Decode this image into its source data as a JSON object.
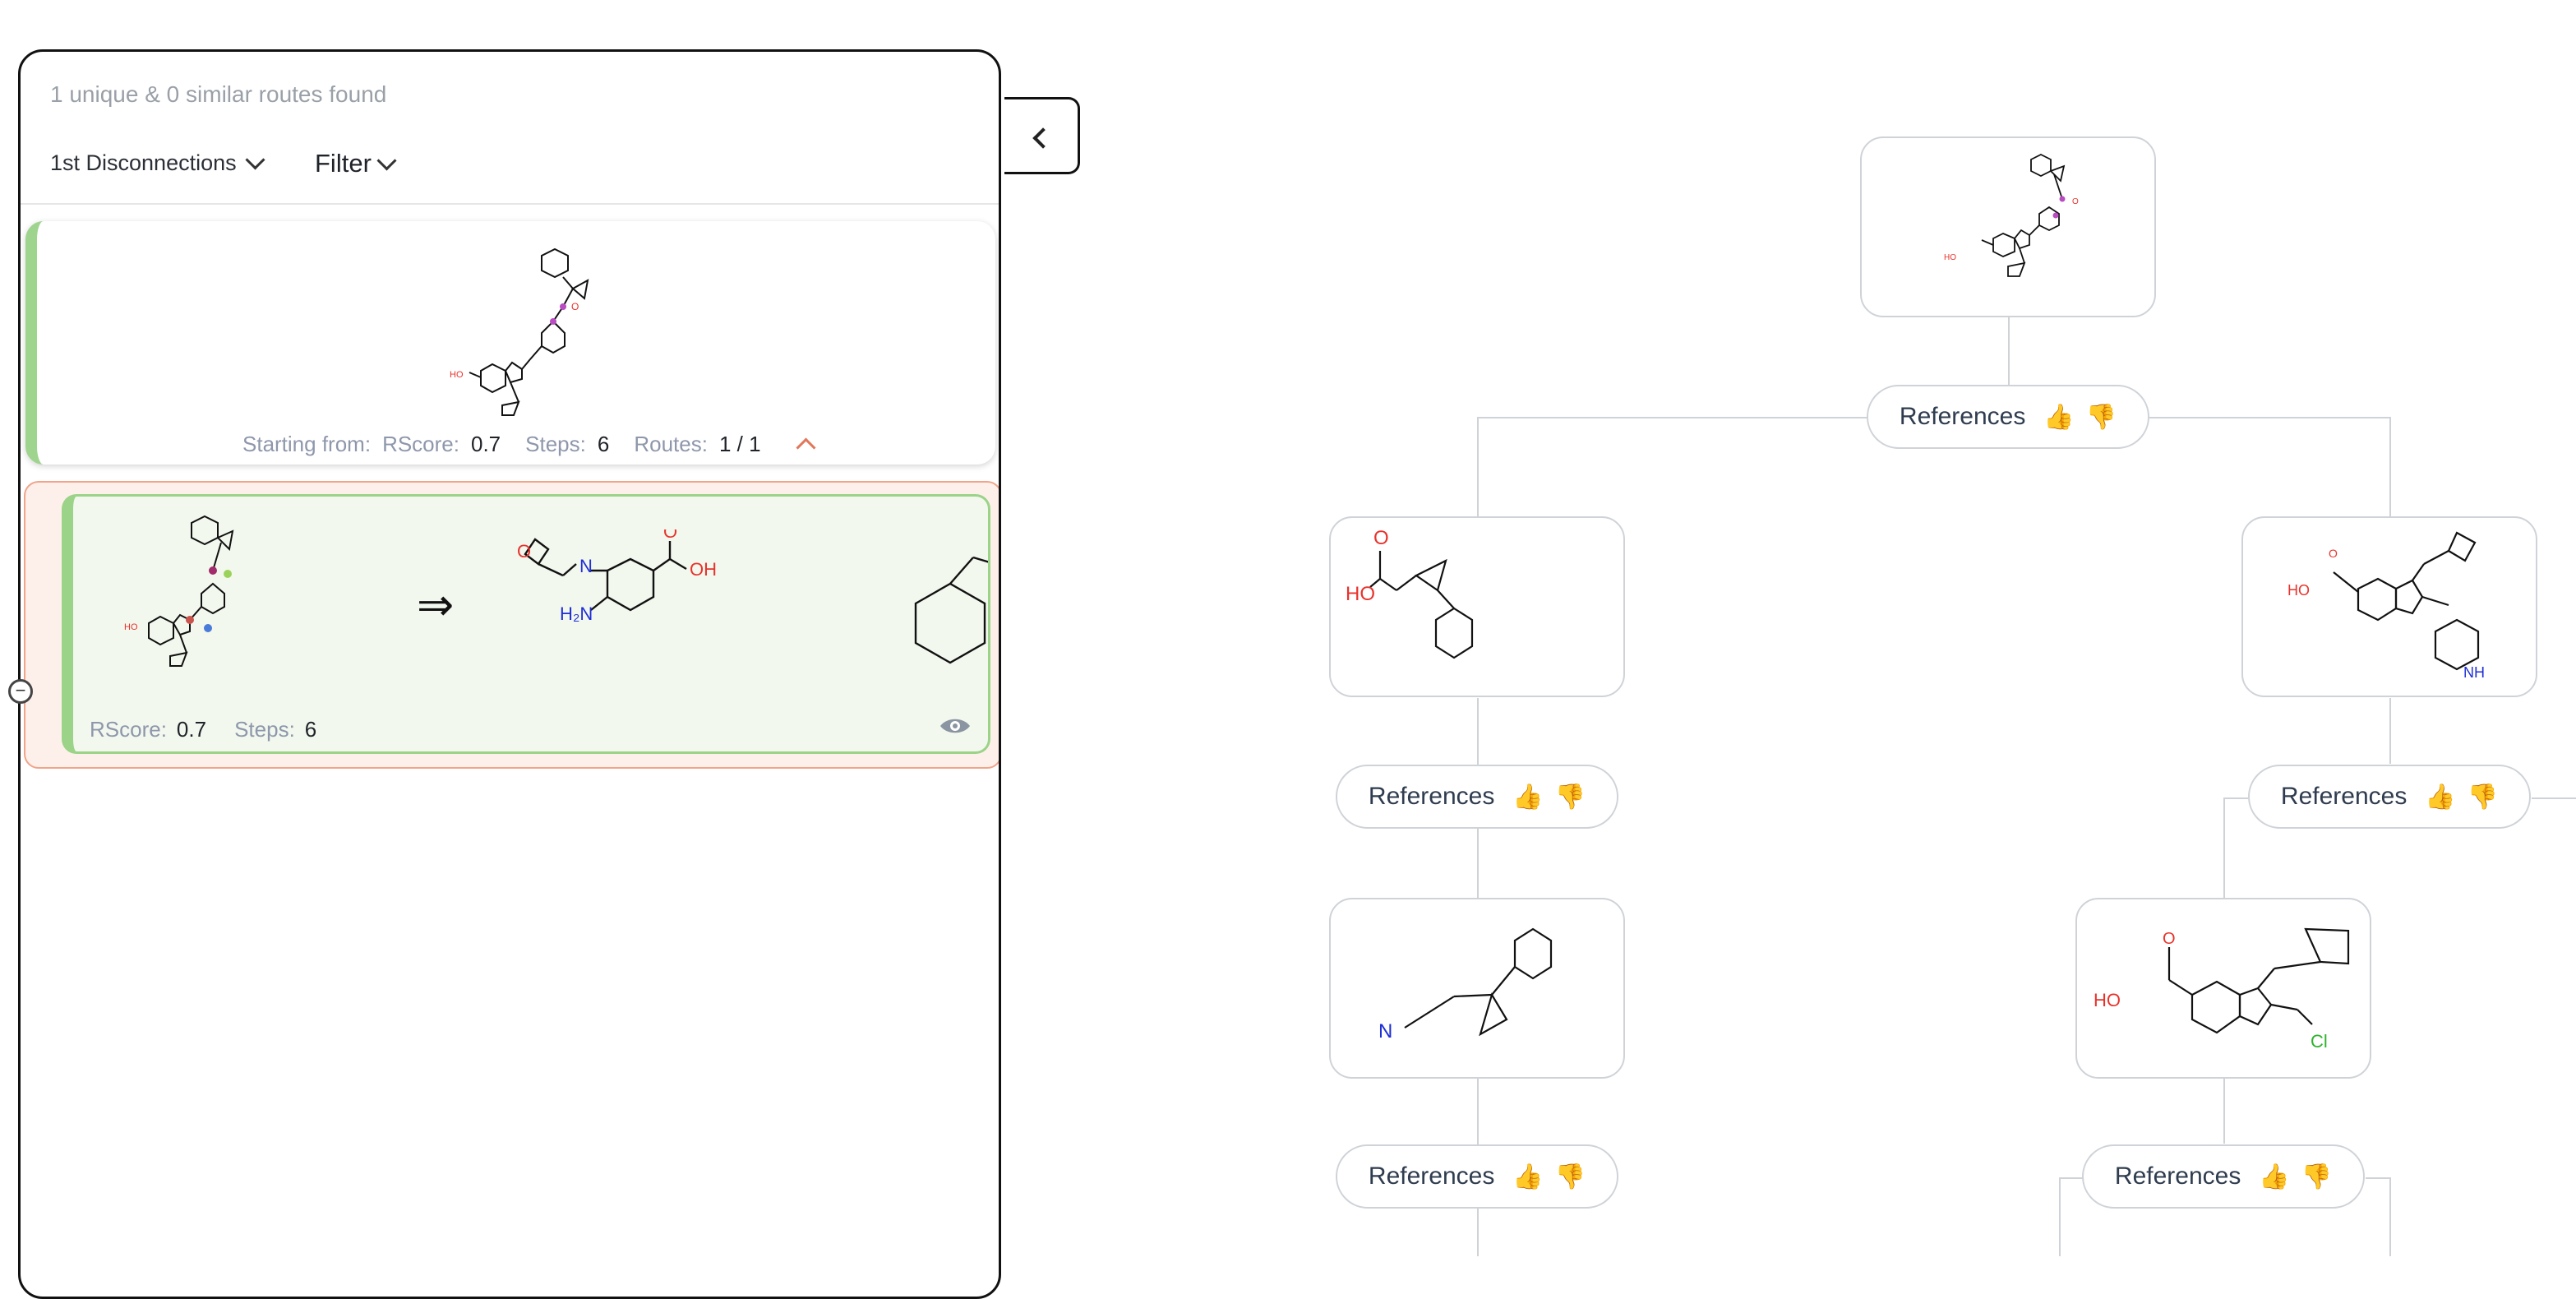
{
  "sidebar": {
    "summary": "1 unique & 0 similar routes found",
    "disconnections_label": "1st Disconnections",
    "filter_label": "Filter"
  },
  "target": {
    "starting_from_label": "Starting from:",
    "rscore_label": "RScore:",
    "rscore_value": "0.7",
    "steps_label": "Steps:",
    "steps_value": "6",
    "routes_label": "Routes:",
    "routes_value": "1 / 1"
  },
  "route": {
    "arrow": "⇒",
    "rscore_label": "RScore:",
    "rscore_value": "0.7",
    "steps_label": "Steps:",
    "steps_value": "6"
  },
  "tree": {
    "reference_label": "References"
  },
  "molecule_labels": {
    "ho": "HO",
    "oh": "OH",
    "o": "O",
    "n": "N",
    "nh": "NH",
    "h2n": "H₂N",
    "cl": "Cl"
  },
  "colors": {
    "accent_green": "#9bd388",
    "selected_route_bg": "#fdf0ea",
    "selected_route_border": "#f0a48a",
    "oxygen": "#e8322b",
    "nitrogen": "#1f2fd6",
    "chlorine": "#2db32d"
  }
}
